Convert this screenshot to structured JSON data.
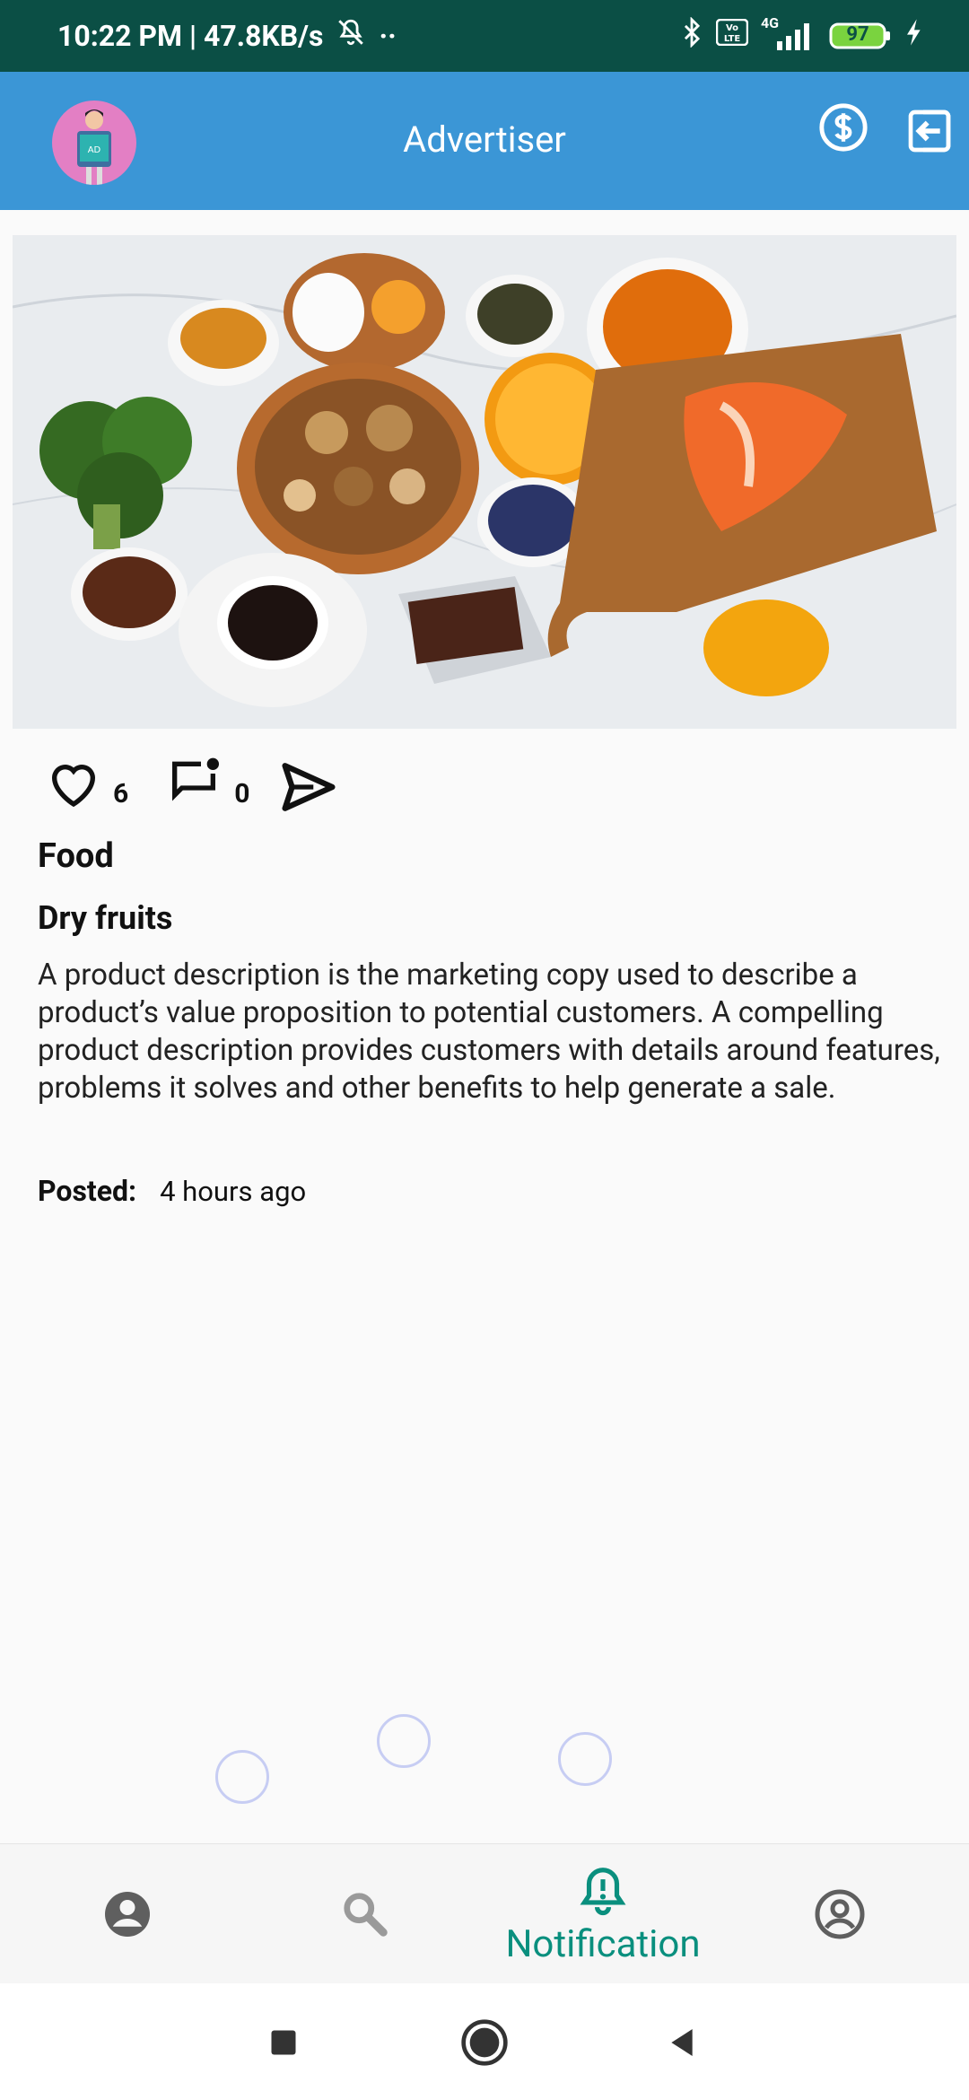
{
  "status_bar": {
    "time_speed": "10:22 PM | 47.8KB/s",
    "dots": "··",
    "network": "4G",
    "battery": "97"
  },
  "app_bar": {
    "title": "Advertiser",
    "avatar_text": "AD"
  },
  "post": {
    "image_alt": "Healthy food assortment",
    "likes": "6",
    "comments": "0",
    "category": "Food",
    "subcategory": "Dry fruits",
    "description": "A product description is the marketing copy used to describe a product’s value proposition to potential customers. A compelling product description provides customers with details around features, problems it solves and other benefits to help generate a sale.",
    "posted_label": "Posted:",
    "posted_value": "4 hours ago"
  },
  "bottom_nav": {
    "items": [
      {
        "name": "profile",
        "icon": "account-circle-icon"
      },
      {
        "name": "search",
        "icon": "search-icon"
      },
      {
        "name": "notification",
        "icon": "bell-alert-icon",
        "label": "Notification",
        "active": true
      },
      {
        "name": "account",
        "icon": "account-outline-icon"
      }
    ],
    "active_color": "#0a8f7e",
    "inactive_color": "#5f5f5f"
  },
  "colors": {
    "status_bar": "#0b4f45",
    "app_bar": "#3b96d6",
    "avatar_bg": "#e37fc4"
  }
}
